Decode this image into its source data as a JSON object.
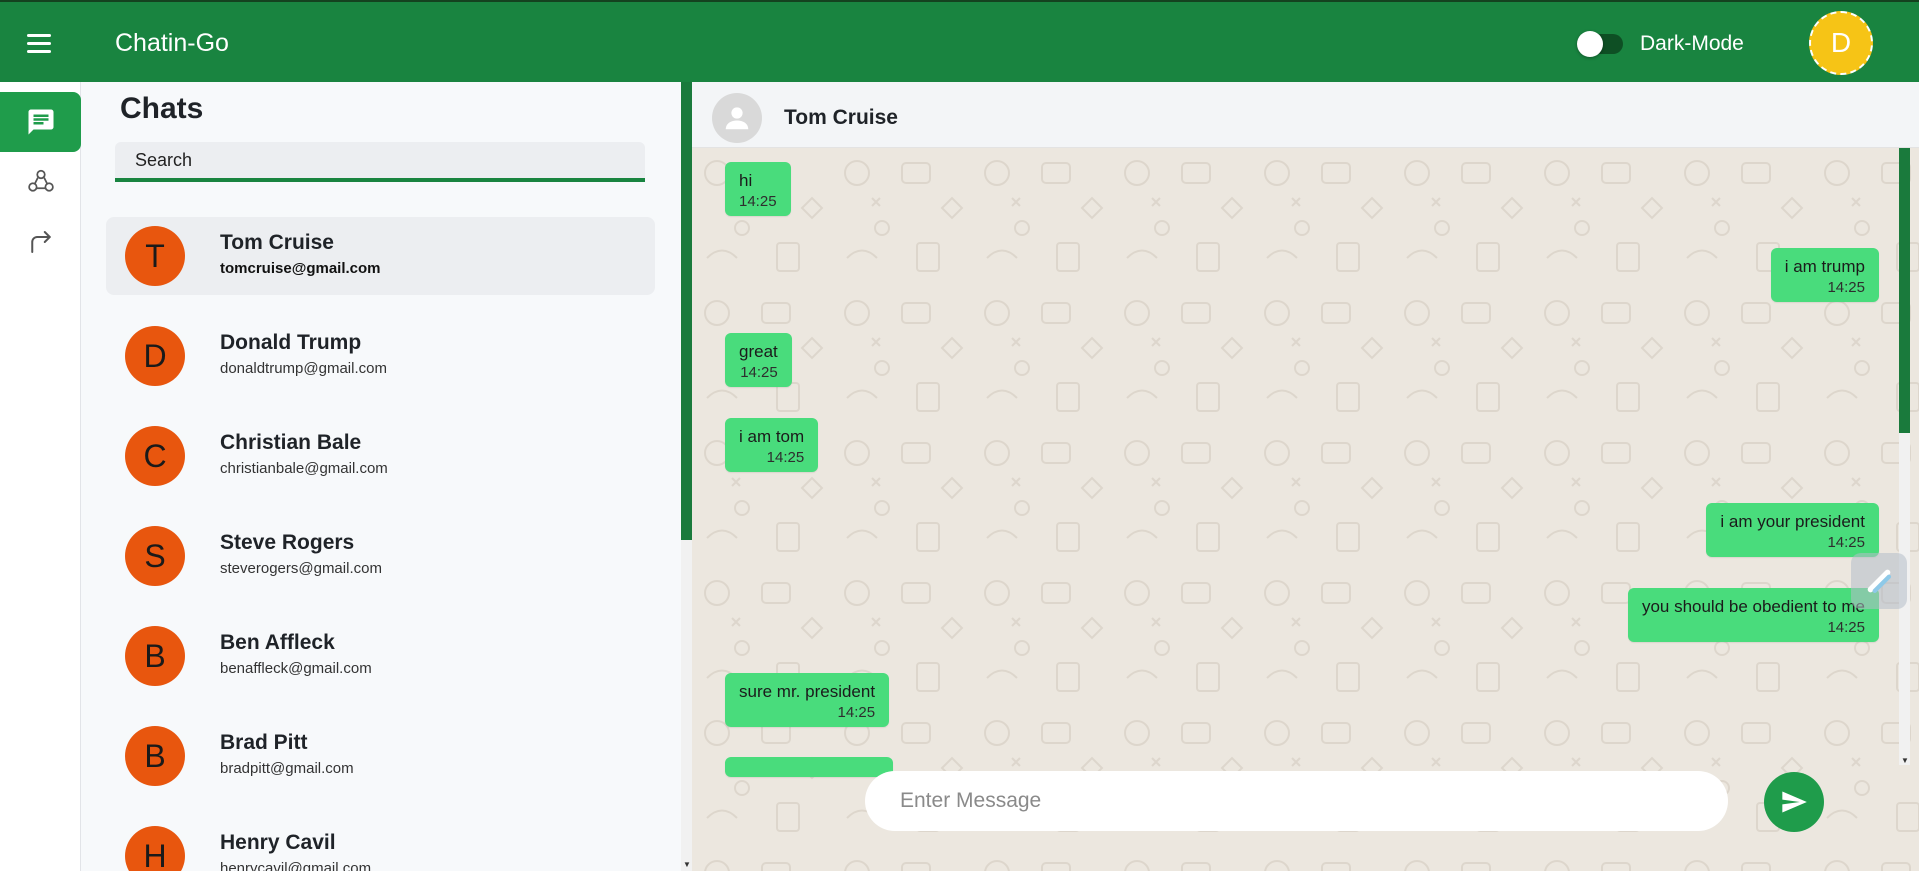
{
  "app": {
    "title": "Chatin-Go",
    "dark_mode_label": "Dark-Mode",
    "dark_mode_on": false,
    "user_initial": "D",
    "accent": "#198440",
    "avatar_color": "#f6c416"
  },
  "rail": {
    "items": [
      {
        "icon": "chat-icon",
        "active": true
      },
      {
        "icon": "group-icon",
        "active": false
      },
      {
        "icon": "logout-icon",
        "active": false
      }
    ]
  },
  "chats": {
    "heading": "Chats",
    "search_placeholder": "Search",
    "items": [
      {
        "initial": "T",
        "name": "Tom Cruise",
        "email": "tomcruise@gmail.com",
        "selected": true
      },
      {
        "initial": "D",
        "name": "Donald Trump",
        "email": "donaldtrump@gmail.com"
      },
      {
        "initial": "C",
        "name": "Christian Bale",
        "email": "christianbale@gmail.com"
      },
      {
        "initial": "S",
        "name": "Steve Rogers",
        "email": "steverogers@gmail.com"
      },
      {
        "initial": "B",
        "name": "Ben Affleck",
        "email": "benaffleck@gmail.com"
      },
      {
        "initial": "B",
        "name": "Brad Pitt",
        "email": "bradpitt@gmail.com"
      },
      {
        "initial": "H",
        "name": "Henry Cavil",
        "email": "henrycavil@gmail.com"
      }
    ]
  },
  "conversation": {
    "contact_name": "Tom Cruise",
    "messages": [
      {
        "side": "left",
        "text": "hi",
        "time": "14:25"
      },
      {
        "side": "right",
        "text": "i am trump",
        "time": "14:25"
      },
      {
        "side": "left",
        "text": "great",
        "time": "14:25"
      },
      {
        "side": "left",
        "text": "i am tom",
        "time": "14:25"
      },
      {
        "side": "right",
        "text": "i am your president",
        "time": "14:25"
      },
      {
        "side": "right",
        "text": "you should be obedient to me",
        "time": "14:25"
      },
      {
        "side": "left",
        "text": "sure mr. president",
        "time": "14:25"
      }
    ],
    "composer_placeholder": "Enter Message"
  }
}
